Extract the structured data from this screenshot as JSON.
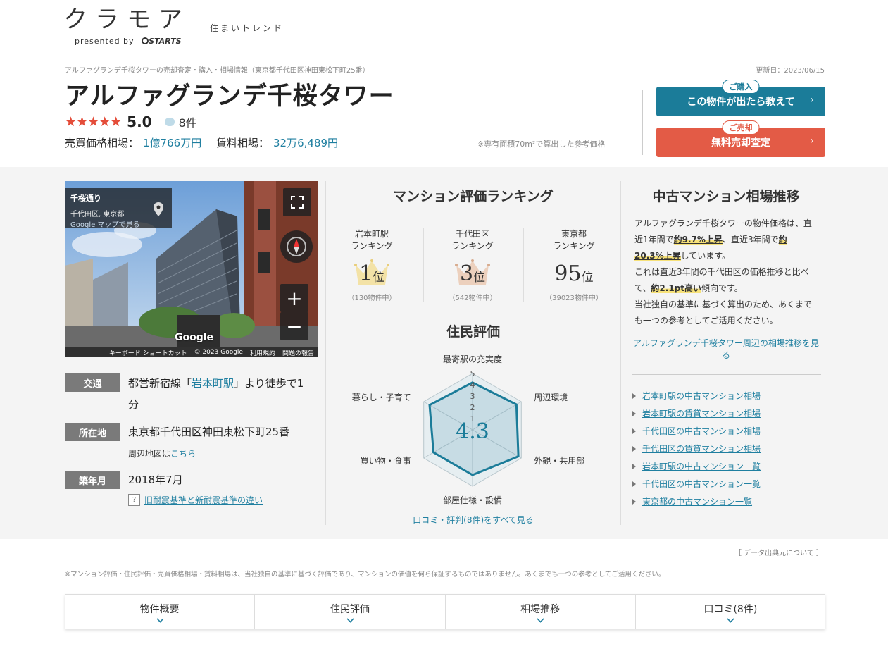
{
  "header": {
    "logo": "クラモア",
    "presented_by": "presented by",
    "brand": "STARTS",
    "tagline": "住まいトレンド"
  },
  "property": {
    "breadcrumb": "アルファグランデ千桜タワーの売却査定・購入・相場情報（東京都千代田区神田東松下町25番）",
    "updated": "更新日：2023/06/15",
    "title": "アルファグランデ千桜タワー",
    "stars": "★★★★★",
    "score": "5.0",
    "review_count": "8件",
    "sale_label": "売買価格相場：",
    "sale_value": "1億766万円",
    "rent_label": "賃料相場：",
    "rent_value": "32万6,489円",
    "price_note": "※専有面積70m²で算出した参考価格"
  },
  "cta": {
    "buy_tag": "ご購入",
    "buy_label": "この物件が出たら教えて",
    "sell_tag": "ご売却",
    "sell_label": "無料売却査定",
    "arrow": "›",
    "buy_color": "#1b7c99",
    "sell_color": "#e35b46"
  },
  "streetview": {
    "place": "千桜通り",
    "area": "千代田区, 東京都",
    "maps_link": "Google マップで見る",
    "google": "Google",
    "footer": [
      "キーボード ショートカット",
      "© 2023 Google",
      "利用規約",
      "問題の報告"
    ]
  },
  "info": {
    "access_label": "交通",
    "access_pre": "都営新宿線「",
    "access_station": "岩本町駅",
    "access_post": "」より徒歩で1",
    "access_line2": "分",
    "address_label": "所在地",
    "address_value": "東京都千代田区神田東松下町25番",
    "map_pre": "周辺地図は",
    "map_link": "こちら",
    "built_label": "築年月",
    "built_value": "2018年7月",
    "quake_link": "旧耐震基準と新耐震基準の違い",
    "quake_icon": "?"
  },
  "ranking": {
    "title": "マンション評価ランキング",
    "items": [
      {
        "line1": "岩本町駅",
        "line2": "ランキング",
        "rank": "1",
        "unit": "位",
        "count": "（130物件中）"
      },
      {
        "line1": "千代田区",
        "line2": "ランキング",
        "rank": "3",
        "unit": "位",
        "count": "（542物件中）"
      },
      {
        "line1": "東京都",
        "line2": "ランキング",
        "rank": "95",
        "unit": "位",
        "count": "（39023物件中）"
      }
    ]
  },
  "resident": {
    "title": "住民評価",
    "score": "4.3",
    "axes": [
      "最寄駅の充実度",
      "周辺環境",
      "外観・共用部",
      "部屋仕様・設備",
      "買い物・食事",
      "暮らし・子育て"
    ],
    "values": [
      4.2,
      4.5,
      4.7,
      4.0,
      4.0,
      4.4
    ],
    "scale": [
      "1",
      "2",
      "3",
      "4",
      "5"
    ],
    "reviews_link": "口コミ・評判(8件)をすべて見る",
    "color": "#1b7c99"
  },
  "market": {
    "title": "中古マンション相場推移",
    "p1_a": "アルファグランデ千桜タワーの物件価格は、直近1年間で",
    "p1_hl1": "約9.7%上昇",
    "p1_b": "、直近3年間で",
    "p1_hl2": "約20.3%上昇",
    "p1_c": "しています。",
    "p2_a": "これは直近3年間の千代田区の価格推移と比べて、",
    "p2_hl": "約2.1pt高い",
    "p2_b": "傾向です。",
    "p3": "当社独自の基準に基づく算出のため、あくまでも一つの参考としてご活用ください。",
    "trend_link": "アルファグランデ千桜タワー周辺の相場推移を見る",
    "links": [
      "岩本町駅の中古マンション相場",
      "岩本町駅の賃貸マンション相場",
      "千代田区の中古マンション相場",
      "千代田区の賃貸マンション相場",
      "岩本町駅の中古マンション一覧",
      "千代田区の中古マンション一覧",
      "東京都の中古マンション一覧"
    ]
  },
  "footer": {
    "data_source": "［ データ出典元について ］",
    "disclaimer": "※マンション評価・住民評価・売買価格相場・賃料相場は、当社独自の基準に基づく評価であり、マンションの価値を何ら保証するものではありません。あくまでも一つの参考としてご活用ください。",
    "tabs": [
      "物件概要",
      "住民評価",
      "相場推移",
      "口コミ(8件)"
    ]
  }
}
